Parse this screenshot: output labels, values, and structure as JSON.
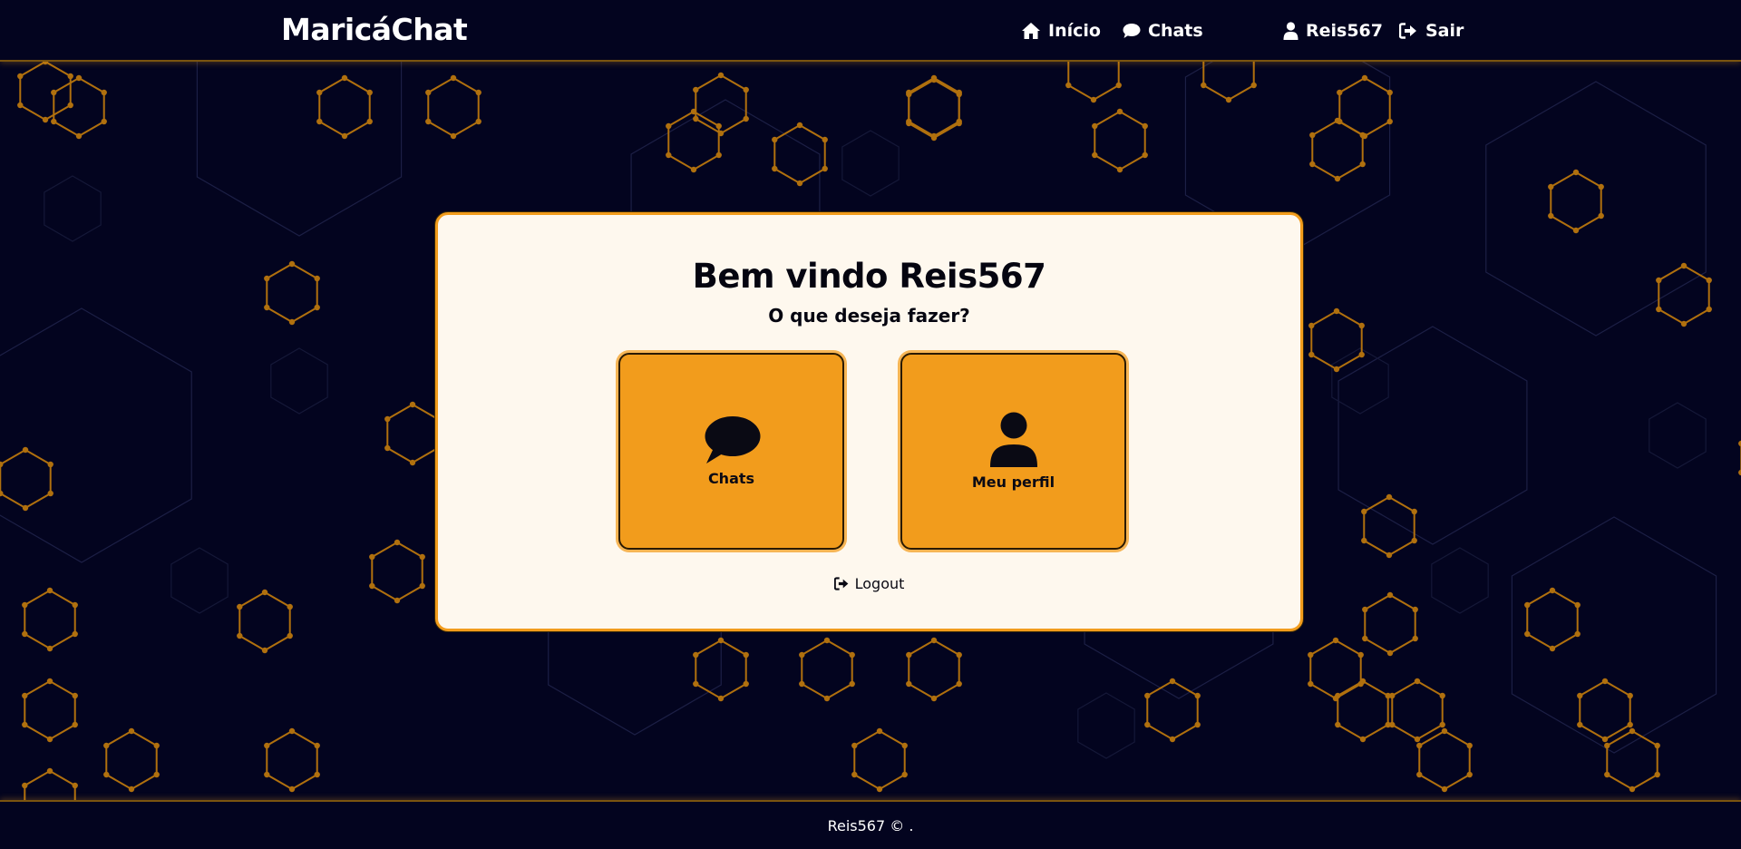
{
  "brand": {
    "name": "MaricáChat"
  },
  "nav": {
    "inicio": "Início",
    "chats": "Chats",
    "username": "Reis567",
    "sair": "Sair"
  },
  "card": {
    "title": "Bem vindo Reis567",
    "subtitle": "O que deseja fazer?",
    "tiles": [
      {
        "label": "Chats",
        "icon": "speech-bubble-icon"
      },
      {
        "label": "Meu perfil",
        "icon": "user-icon"
      }
    ],
    "logout": "Logout"
  },
  "footer": {
    "text": "Reis567 © ."
  },
  "colors": {
    "background": "#03041f",
    "accent": "#f29c1c",
    "card": "#fef8ee",
    "hex_pattern": "#b0700e"
  }
}
